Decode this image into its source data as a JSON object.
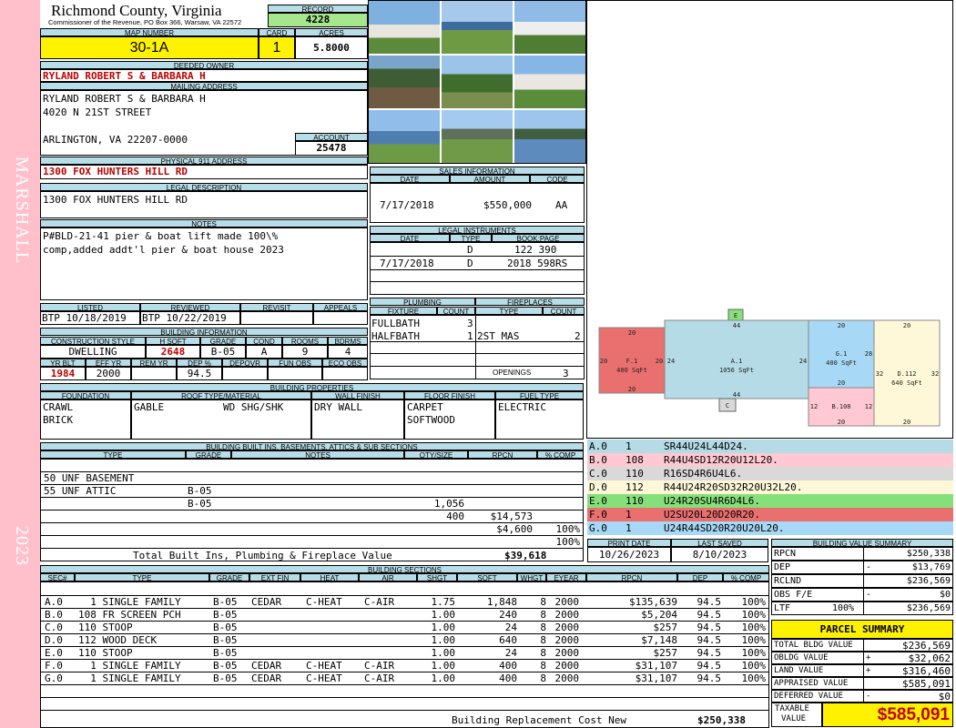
{
  "header": {
    "county": "Richmond County, Virginia",
    "commissioner": "Commissioner of the Revenue, PO Box 366, Warsaw, VA 22572",
    "record_label": "RECORD",
    "record": "4228",
    "map_label": "MAP NUMBER",
    "map_number": "30-1A",
    "card_label": "CARD",
    "card": "1",
    "acres_label": "ACRES",
    "acres": "5.8000"
  },
  "sidebar": {
    "district": "MARSHALL",
    "year": "2023"
  },
  "owner": {
    "label": "DEEDED OWNER",
    "name": "RYLAND ROBERT S & BARBARA H",
    "mailing_label": "MAILING ADDRESS",
    "mail1": "RYLAND ROBERT S & BARBARA H",
    "mail2": "4020 N 21ST STREET",
    "mail3": "ARLINGTON, VA 22207-0000",
    "account_label": "ACCOUNT",
    "account": "25478",
    "phys_label": "PHYSICAL 911 ADDRESS",
    "phys": "1300 FOX HUNTERS HILL RD",
    "legal_label": "LEGAL DESCRIPTION",
    "legal": "1300 FOX HUNTERS HILL RD",
    "notes_label": "NOTES",
    "notes1": "P#BLD-21-41 pier & boat lift made 100\\%",
    "notes2": "comp,added addt'l pier & boat house 2023"
  },
  "review": {
    "listed_label": "LISTED",
    "listed": "BTP 10/18/2019",
    "reviewed_label": "REVIEWED",
    "reviewed": "BTP 10/22/2019",
    "revisit_label": "REVISIT",
    "appeals_label": "APPEALS"
  },
  "building_info": {
    "label": "BUILDING INFORMATION",
    "h": [
      "CONSTRUCTION STYLE",
      "H SQFT",
      "GRADE",
      "COND",
      "ROOMS",
      "BDRMS"
    ],
    "v": [
      "DWELLING",
      "2648",
      "B-05",
      "A",
      "9",
      "4"
    ],
    "h2": [
      "YR BLT",
      "EFF YR",
      "REM YR",
      "DEP %",
      "DEPOVR",
      "FUN OBS",
      "ECO OBS"
    ],
    "v2": [
      "1984",
      "2000",
      "",
      "94.5",
      "",
      "",
      ""
    ]
  },
  "properties": {
    "label": "BUILDING PROPERTIES",
    "h": [
      "FOUNDATION",
      "ROOF TYPE/MATERIAL",
      "WALL FINISH",
      "FLOOR FINISH",
      "FUEL TYPE"
    ],
    "foundation1": "CRAWL",
    "foundation2": "BRICK",
    "roof_type": "GABLE",
    "roof_mat": "WD SHG/SHK",
    "wall": "DRY WALL",
    "floor1": "CARPET",
    "floor2": "SOFTWOOD",
    "fuel": "ELECTRIC"
  },
  "sales": {
    "label": "SALES INFORMATION",
    "h": [
      "DATE",
      "AMOUNT",
      "CODE"
    ],
    "date": "7/17/2018",
    "amount": "$550,000",
    "code": "AA"
  },
  "instruments": {
    "label": "LEGAL INSTRUMENTS",
    "h": [
      "DATE",
      "TYPE",
      "BOOK:PAGE"
    ],
    "rows": [
      {
        "date": "",
        "type": "D",
        "book": "122 390"
      },
      {
        "date": "7/17/2018",
        "type": "D",
        "book": "2018 598RS"
      }
    ]
  },
  "plumbing": {
    "label": "PLUMBING",
    "h": [
      "FIXTURE",
      "COUNT"
    ],
    "rows": [
      {
        "f": "FULLBATH",
        "c": "3"
      },
      {
        "f": "HALFBATH",
        "c": "1"
      }
    ]
  },
  "fireplaces": {
    "label": "FIREPLACES",
    "h": [
      "TYPE",
      "COUNT"
    ],
    "type": "2ST MAS",
    "count": "2",
    "openings_label": "OPENINGS",
    "openings": "3"
  },
  "builtins": {
    "label": "BUILDING BUILT INS, BASEMENTS, ATTICS & SUB SECTIONS",
    "h": [
      "TYPE",
      "GRADE",
      "NOTES",
      "QTY/SIZE",
      "RPCN",
      "% COMP"
    ],
    "rows": [
      {
        "type": "50 UNF BASEMENT",
        "grade": "B-05",
        "qty": "1,056",
        "rpcn": "$14,573",
        "comp": "100%"
      },
      {
        "type": "55 UNF ATTIC",
        "grade": "B-05",
        "qty": "400",
        "rpcn": "$4,600",
        "comp": "100%"
      }
    ],
    "total_label": "Total Built Ins, Plumbing & Fireplace Value",
    "total": "$39,618"
  },
  "sections": {
    "label": "BUILDING SECTIONS",
    "h": [
      "SEC#",
      "TYPE",
      "GRADE",
      "EXT FIN",
      "HEAT",
      "AIR",
      "SHGT",
      "SQFT",
      "WHGT",
      "EYEAR",
      "RPCN",
      "DEP",
      "% COMP"
    ],
    "rows": [
      {
        "sec": "A.0",
        "type": "  1 SINGLE FAMILY",
        "grade": "B-05",
        "ext": "CEDAR",
        "heat": "C-HEAT",
        "air": "C-AIR",
        "shgt": "1.75",
        "sqft": "1,848",
        "whgt": "8",
        "eyear": "2000",
        "rpcn": "$135,639",
        "dep": "94.5",
        "comp": "100%"
      },
      {
        "sec": "B.0",
        "type": "108 FR SCREEN PCH",
        "grade": "B-05",
        "ext": "",
        "heat": "",
        "air": "",
        "shgt": "1.00",
        "sqft": "240",
        "whgt": "8",
        "eyear": "2000",
        "rpcn": "$5,204",
        "dep": "94.5",
        "comp": "100%"
      },
      {
        "sec": "C.0",
        "type": "110 STOOP",
        "grade": "B-05",
        "ext": "",
        "heat": "",
        "air": "",
        "shgt": "1.00",
        "sqft": "24",
        "whgt": "8",
        "eyear": "2000",
        "rpcn": "$257",
        "dep": "94.5",
        "comp": "100%"
      },
      {
        "sec": "D.0",
        "type": "112 WOOD DECK",
        "grade": "B-05",
        "ext": "",
        "heat": "",
        "air": "",
        "shgt": "1.00",
        "sqft": "640",
        "whgt": "8",
        "eyear": "2000",
        "rpcn": "$7,148",
        "dep": "94.5",
        "comp": "100%"
      },
      {
        "sec": "E.0",
        "type": "110 STOOP",
        "grade": "B-05",
        "ext": "",
        "heat": "",
        "air": "",
        "shgt": "1.00",
        "sqft": "24",
        "whgt": "8",
        "eyear": "2000",
        "rpcn": "$257",
        "dep": "94.5",
        "comp": "100%"
      },
      {
        "sec": "F.0",
        "type": "  1 SINGLE FAMILY",
        "grade": "B-05",
        "ext": "CEDAR",
        "heat": "C-HEAT",
        "air": "C-AIR",
        "shgt": "1.00",
        "sqft": "400",
        "whgt": "8",
        "eyear": "2000",
        "rpcn": "$31,107",
        "dep": "94.5",
        "comp": "100%"
      },
      {
        "sec": "G.0",
        "type": "  1 SINGLE FAMILY",
        "grade": "B-05",
        "ext": "CEDAR",
        "heat": "C-HEAT",
        "air": "C-AIR",
        "shgt": "1.00",
        "sqft": "400",
        "whgt": "8",
        "eyear": "2000",
        "rpcn": "$31,107",
        "dep": "94.5",
        "comp": "100%"
      }
    ],
    "rcn_label": "Building Replacement Cost New",
    "rcn": "$250,338"
  },
  "sketch": {
    "labels": {
      "F": "F.1",
      "F_area": "400 SqFt",
      "A": "A.1",
      "A_area": "1056 SqFt",
      "G": "G.1",
      "G_area": "400 SqFt",
      "D": "D.112",
      "D_area": "640 SqFt",
      "B": "B.108",
      "C": "C",
      "E": "E"
    },
    "dims": [
      "20",
      "20",
      "20",
      "20",
      "44",
      "44",
      "24",
      "24",
      "20",
      "20",
      "28",
      "20",
      "12",
      "12",
      "20",
      "20",
      "32",
      "32",
      "20"
    ]
  },
  "vectors": {
    "rows": [
      {
        "id": "A.0",
        "code": "1",
        "vec": "SR44U24L44D24.",
        "color": "#b4dbe6"
      },
      {
        "id": "B.0",
        "code": "108",
        "vec": "R44U4SD12R20U12L20.",
        "color": "#ffc8d2"
      },
      {
        "id": "C.0",
        "code": "110",
        "vec": "R16SD4R6U4L6.",
        "color": "#d9d9d9"
      },
      {
        "id": "D.0",
        "code": "112",
        "vec": "R44U24R20SD32R20U32L20.",
        "color": "#fff8d8"
      },
      {
        "id": "E.0",
        "code": "110",
        "vec": "U24R20SU4R6D4L6.",
        "color": "#86e07a"
      },
      {
        "id": "F.0",
        "code": "1",
        "vec": "U2SU20L20D20R20.",
        "color": "#ea6f6f"
      },
      {
        "id": "G.0",
        "code": "1",
        "vec": "U24R44SD20R20U20L20.",
        "color": "#a7d8f5"
      }
    ]
  },
  "dates": {
    "print_label": "PRINT DATE",
    "print": "10/26/2023",
    "saved_label": "LAST SAVED",
    "saved": "8/10/2023"
  },
  "value_summary": {
    "label": "BUILDING VALUE SUMMARY",
    "rows": [
      {
        "l": "RPCN",
        "s": "",
        "v": "$250,338"
      },
      {
        "l": "DEP",
        "s": "-",
        "v": "$13,769"
      },
      {
        "l": "RCLND",
        "s": "",
        "v": "$236,569"
      },
      {
        "l": "OBS F/E",
        "s": "-",
        "v": "$0"
      },
      {
        "l": "LTF",
        "s": "100%",
        "v": "$236,569"
      }
    ]
  },
  "parcel": {
    "label": "PARCEL SUMMARY",
    "rows": [
      {
        "l": "TOTAL BLDG VALUE",
        "s": "",
        "v": "$236,569"
      },
      {
        "l": "OBLDG VALUE",
        "s": "+",
        "v": "$32,062"
      },
      {
        "l": "LAND VALUE",
        "s": "+",
        "v": "$316,460"
      },
      {
        "l": "APPRAISED VALUE",
        "s": "",
        "v": "$585,091"
      },
      {
        "l": "DEFERRED VALUE",
        "s": "-",
        "v": "$0"
      }
    ],
    "taxable_label1": "TAXABLE",
    "taxable_label2": "VALUE",
    "taxable": "$585,091"
  }
}
